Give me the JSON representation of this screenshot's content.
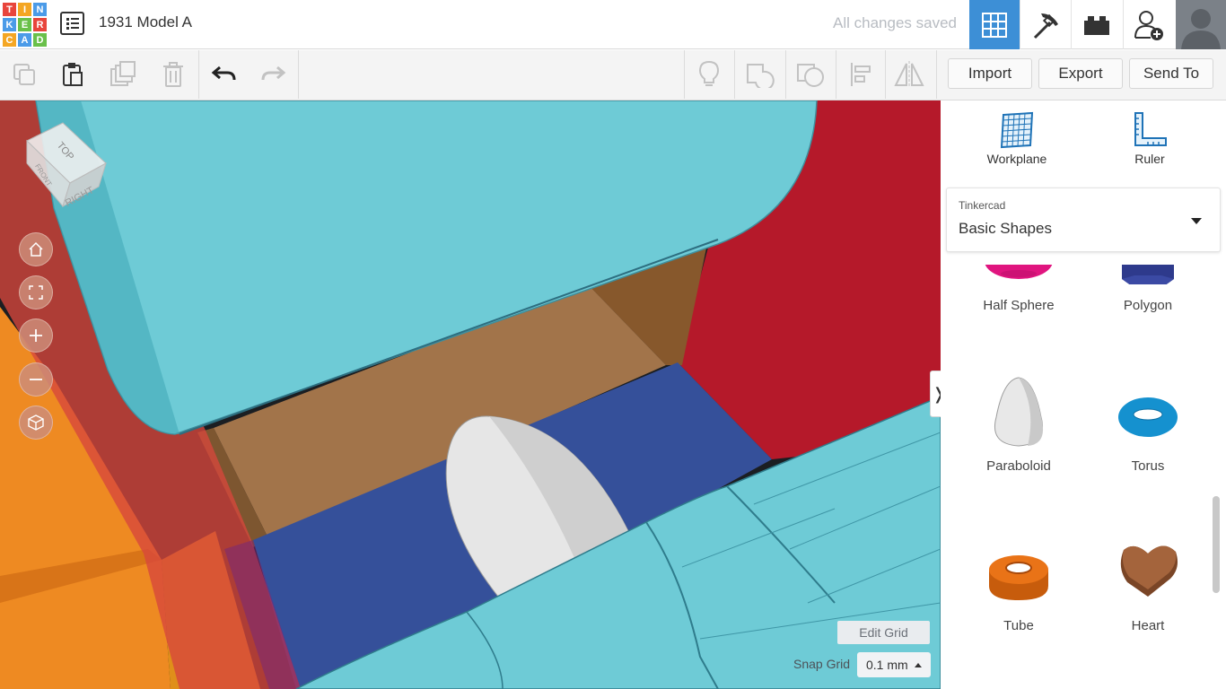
{
  "app": {
    "logo_letters": [
      "T",
      "I",
      "N",
      "K",
      "E",
      "R",
      "C",
      "A",
      "D"
    ],
    "logo_colors": [
      "#e8453c",
      "#f4a623",
      "#4b9be8",
      "#4b9be8",
      "#6ac04a",
      "#e8453c",
      "#f4a623",
      "#4b9be8",
      "#6ac04a"
    ],
    "design_title": "1931 Model A",
    "save_status": "All changes saved",
    "accent_color": "#3d8fd6"
  },
  "top_nav": {
    "icons": [
      "3d-view-grid-icon",
      "pickaxe-icon",
      "brick-icon",
      "add-user-icon",
      "avatar"
    ]
  },
  "toolbar": {
    "icons": [
      "copy-icon",
      "paste-icon",
      "duplicate-icon",
      "delete-icon",
      "undo-icon",
      "redo-icon",
      "show-all-icon",
      "group-icon",
      "ungroup-icon",
      "align-icon",
      "mirror-icon"
    ],
    "import_label": "Import",
    "export_label": "Export",
    "send_to_label": "Send To"
  },
  "viewcube": {
    "top_label": "TOP",
    "right_label": "RIGHT",
    "front_label": "FRONT"
  },
  "view_controls": [
    "home-icon",
    "fit-view-icon",
    "zoom-in-icon",
    "zoom-out-icon",
    "projection-icon"
  ],
  "grid": {
    "edit_label": "Edit Grid",
    "snap_label": "Snap Grid",
    "snap_value": "0.1 mm"
  },
  "panel": {
    "workplane_label": "Workplane",
    "ruler_label": "Ruler",
    "library_provider": "Tinkercad",
    "library_name": "Basic Shapes",
    "shapes": [
      {
        "label": "Half Sphere",
        "color": "#e0157f"
      },
      {
        "label": "Polygon",
        "color": "#2e3a8c"
      },
      {
        "label": "Paraboloid",
        "color": "#d9d9d9"
      },
      {
        "label": "Torus",
        "color": "#1591cf"
      },
      {
        "label": "Tube",
        "color": "#e06b12"
      },
      {
        "label": "Heart",
        "color": "#9a5a33"
      }
    ]
  },
  "collapse_tab_glyph": "❭"
}
